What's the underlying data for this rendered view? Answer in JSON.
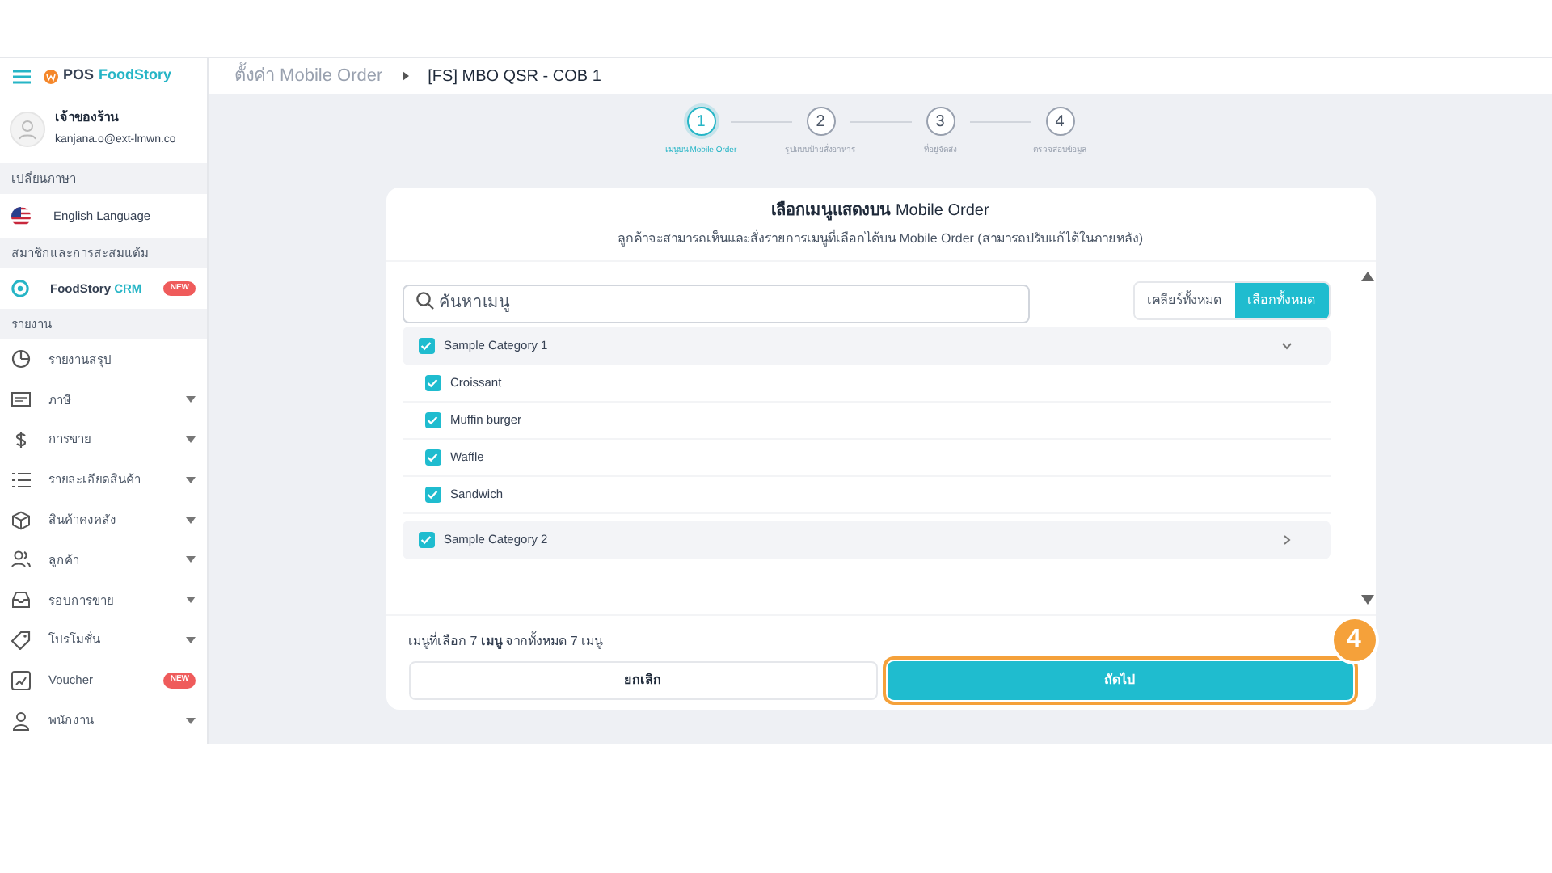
{
  "app": {
    "logo_text": "POS",
    "logo_brand": "FoodStory"
  },
  "profile": {
    "role": "เจ้าของร้าน",
    "email": "kanjana.o@ext-lmwn.co"
  },
  "sidebar": [
    {
      "kind": "section",
      "label": "เปลี่ยนภาษา"
    },
    {
      "kind": "language",
      "label": "English Language"
    },
    {
      "kind": "section",
      "label": "สมาชิกและการสะสมแต้ม"
    },
    {
      "kind": "crm",
      "label": "FoodStory",
      "label_accent": "CRM",
      "badge": "NEW"
    },
    {
      "kind": "section",
      "label": "รายงาน"
    },
    {
      "kind": "item",
      "label": "รายงานสรุป",
      "expandable": false
    },
    {
      "kind": "item",
      "label": "ภาษี",
      "expandable": true
    },
    {
      "kind": "item",
      "label": "การขาย",
      "expandable": true
    },
    {
      "kind": "item",
      "label": "รายละเอียดสินค้า",
      "expandable": true
    },
    {
      "kind": "item",
      "label": "สินค้าคงคลัง",
      "expandable": true
    },
    {
      "kind": "item",
      "label": "ลูกค้า",
      "expandable": true
    },
    {
      "kind": "item",
      "label": "รอบการขาย",
      "expandable": true
    },
    {
      "kind": "item",
      "label": "โปรโมชั่น",
      "expandable": true
    },
    {
      "kind": "item",
      "label": "Voucher",
      "expandable": false,
      "badge": "NEW"
    },
    {
      "kind": "item",
      "label": "พนักงาน",
      "expandable": true
    }
  ],
  "breadcrumb": [
    "ตั้งค่า Mobile Order",
    "[FS] MBO QSR - COB 1"
  ],
  "steps": [
    {
      "number": "1",
      "label": "เมนูบน Mobile Order",
      "selected": true
    },
    {
      "number": "2",
      "label": "รูปแบบป้ายสั่งอาหาร",
      "selected": false
    },
    {
      "number": "3",
      "label": "ที่อยู่จัดส่ง",
      "selected": false
    },
    {
      "number": "4",
      "label": "ตรวจสอบข้อมูล",
      "selected": false
    }
  ],
  "card": {
    "title": "**เลือกเมนูแสดงบน** Mobile Order",
    "subtitle": "ลูกค้าจะสามารถเห็นและสั่งรายการเมนูที่เลือกได้บน Mobile Order (สามารถปรับแก้ได้ในภายหลัง)"
  },
  "search": {
    "placeholder": "ค้นหาเมนู"
  },
  "toggle": [
    {
      "label": "เคลียร์ทั้งหมด",
      "selected": false
    },
    {
      "label": "เลือกทั้งหมด",
      "selected": true
    }
  ],
  "categories": [
    {
      "name": "Sample Category 1",
      "checked": true,
      "expanded": true,
      "items": [
        {
          "name": "Croissant",
          "checked": true
        },
        {
          "name": "Muffin burger",
          "checked": true
        },
        {
          "name": "Waffle",
          "checked": true
        },
        {
          "name": "Sandwich",
          "checked": true
        }
      ]
    },
    {
      "name": "Sample Category 2",
      "checked": true,
      "expanded": false
    }
  ],
  "summary": "เมนูที่เลือก 7 **เมนู** จากทั้งหมด 7 เมนู",
  "buttons": [
    {
      "label": "ยกเลิก",
      "kind": "secondary"
    },
    {
      "label": "ถัดไป",
      "kind": "primary",
      "highlighted": true
    }
  ],
  "annotation": {
    "number": "4"
  }
}
